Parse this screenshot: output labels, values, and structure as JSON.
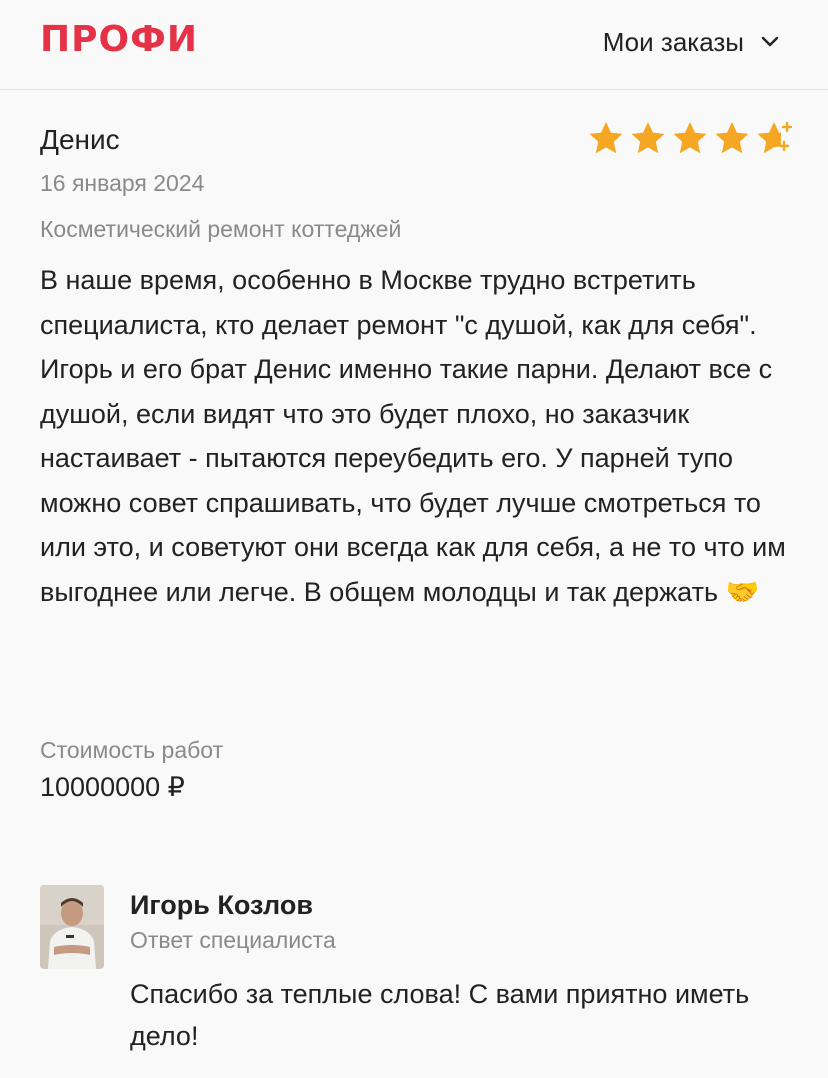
{
  "header": {
    "logo": "ПРОФИ",
    "orders_label": "Мои заказы",
    "brand_color": "#e63247"
  },
  "review": {
    "author": "Денис",
    "rating": 4.5,
    "rating_max": 5,
    "date": "16 января 2024",
    "service": "Косметический ремонт коттеджей",
    "text": "В наше время, особенно в Москве трудно встретить специалиста, кто делает ремонт \"с душой, как для себя\". Игорь и его брат Денис именно такие парни. Делают все с душой, если видят что это будет плохо, но заказчик настаивает - пытаются переубедить его. У парней тупо можно совет спрашивать, что будет лучше смотреться то или это, и советуют они всегда как для себя, а не то что им выгоднее или легче. В общем молодцы и так держать 🤝",
    "price_label": "Стоимость работ",
    "price_value": "10000000 ₽",
    "star_color": "#f5a623"
  },
  "reply": {
    "name": "Игорь Козлов",
    "role": "Ответ специалиста",
    "text": "Спасибо за теплые слова! С вами приятно иметь дело!"
  }
}
